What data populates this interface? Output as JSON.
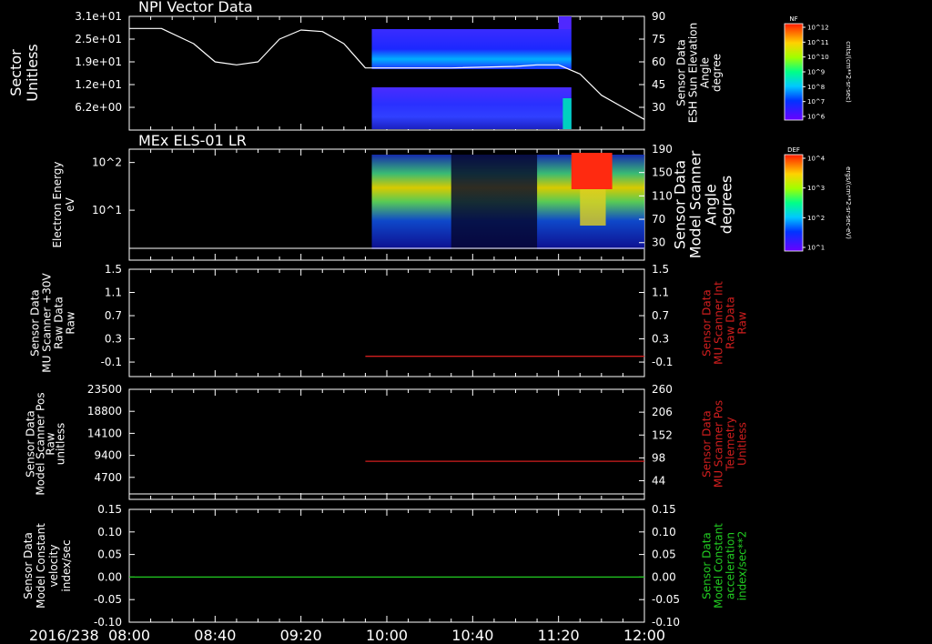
{
  "start_date": "2016/238",
  "time_ticks": [
    "08:00",
    "08:40",
    "09:20",
    "10:00",
    "10:40",
    "11:20",
    "12:00"
  ],
  "colors": {
    "trace_red": "#d21e1e",
    "trace_green": "#22cc22",
    "axes": "#ffffff",
    "background": "#000000"
  },
  "colorbars": [
    {
      "label": "NF",
      "units": "cnts/(cm**2-sr-sec)",
      "ticks": [
        "10^12",
        "10^11",
        "10^10",
        "10^9",
        "10^8",
        "10^7",
        "10^6"
      ]
    },
    {
      "label": "DEF",
      "units": "ergs/(cm**2-sr-sec-eV)",
      "ticks": [
        "10^4",
        "10^3",
        "10^2",
        "10^1"
      ]
    }
  ],
  "chart_data": [
    {
      "type": "heatmap",
      "title": "NPI Vector Data",
      "ylabel": "Sector\nUnitless",
      "y_ticks": [
        "3.1e+01",
        "2.5e+01",
        "1.9e+01",
        "1.2e+01",
        "6.2e+00"
      ],
      "y2label": "Sensor Data\nESH Sun Elevation\nAngle\ndegree",
      "y2_ticks": [
        "90",
        "75",
        "60",
        "45",
        "30"
      ],
      "y2lim": [
        15,
        90
      ],
      "overlay_series": {
        "name": "ESH Sun Elevation Angle",
        "x": [
          "08:00",
          "08:15",
          "08:30",
          "08:40",
          "08:50",
          "09:00",
          "09:10",
          "09:20",
          "09:30",
          "09:40",
          "09:50",
          "10:00",
          "10:30",
          "11:00",
          "11:10",
          "11:20",
          "11:30",
          "11:40",
          "11:50",
          "12:00"
        ],
        "values": [
          82,
          82,
          72,
          60,
          58,
          60,
          75,
          81,
          80,
          72,
          56,
          56,
          56,
          57,
          58,
          58,
          52,
          38,
          30,
          22
        ]
      },
      "data_span": [
        "09:53",
        "11:26"
      ]
    },
    {
      "type": "heatmap",
      "title": "MEx ELS-01 LR",
      "ylabel": "Electron Energy\neV",
      "y_ticks": [
        "10^2",
        "10^1"
      ],
      "y2label": "Sensor Data\nModel Scanner\nAngle\ndegrees",
      "y2_ticks": [
        "190",
        "150",
        "110",
        "70",
        "30"
      ],
      "y2lim": [
        0,
        190
      ],
      "data_span": [
        "09:53",
        "12:00"
      ]
    },
    {
      "type": "line",
      "ylabel": "Sensor Data\nMU Scanner +30V\nRaw Data\nRaw",
      "y_ticks": [
        "1.5",
        "1.1",
        "0.7",
        "0.3",
        "-0.1"
      ],
      "y2label": "Sensor Data\nMU Scanner Int\nRaw Data\nRaw",
      "y2_ticks": [
        "1.5",
        "1.1",
        "0.7",
        "0.3",
        "-0.1"
      ],
      "ylim": [
        -0.35,
        1.5
      ],
      "series": [
        {
          "x": [
            "09:50",
            "12:00"
          ],
          "values": [
            0.0,
            0.0
          ]
        }
      ]
    },
    {
      "type": "line",
      "ylabel": "Sensor Data\nModel Scanner Pos\nRaw\nunitless",
      "y_ticks": [
        "23500",
        "18800",
        "14100",
        "9400",
        "4700"
      ],
      "y2label": "Sensor Data\nMU Scanner Pos\nTelemetry\nUnitless",
      "y2_ticks": [
        "260",
        "206",
        "152",
        "98",
        "44"
      ],
      "y2lim": [
        0,
        260
      ],
      "series": [
        {
          "x": [
            "09:50",
            "12:00"
          ],
          "values": [
            90,
            90
          ]
        }
      ]
    },
    {
      "type": "line",
      "ylabel": "Sensor Data\nModel Constant\nvelocity\nindex/sec",
      "y_ticks": [
        "0.15",
        "0.10",
        "0.05",
        "0.00",
        "-0.05",
        "-0.10"
      ],
      "y2label": "Sensor Data\nModel Constant\nacceleration\nindex/sec**2",
      "y2_ticks": [
        "0.15",
        "0.10",
        "0.05",
        "0.00",
        "-0.05",
        "-0.10"
      ],
      "ylim": [
        -0.1,
        0.15
      ],
      "series": [
        {
          "x": [
            "08:00",
            "12:00"
          ],
          "values": [
            0.0,
            0.0
          ]
        }
      ]
    }
  ]
}
